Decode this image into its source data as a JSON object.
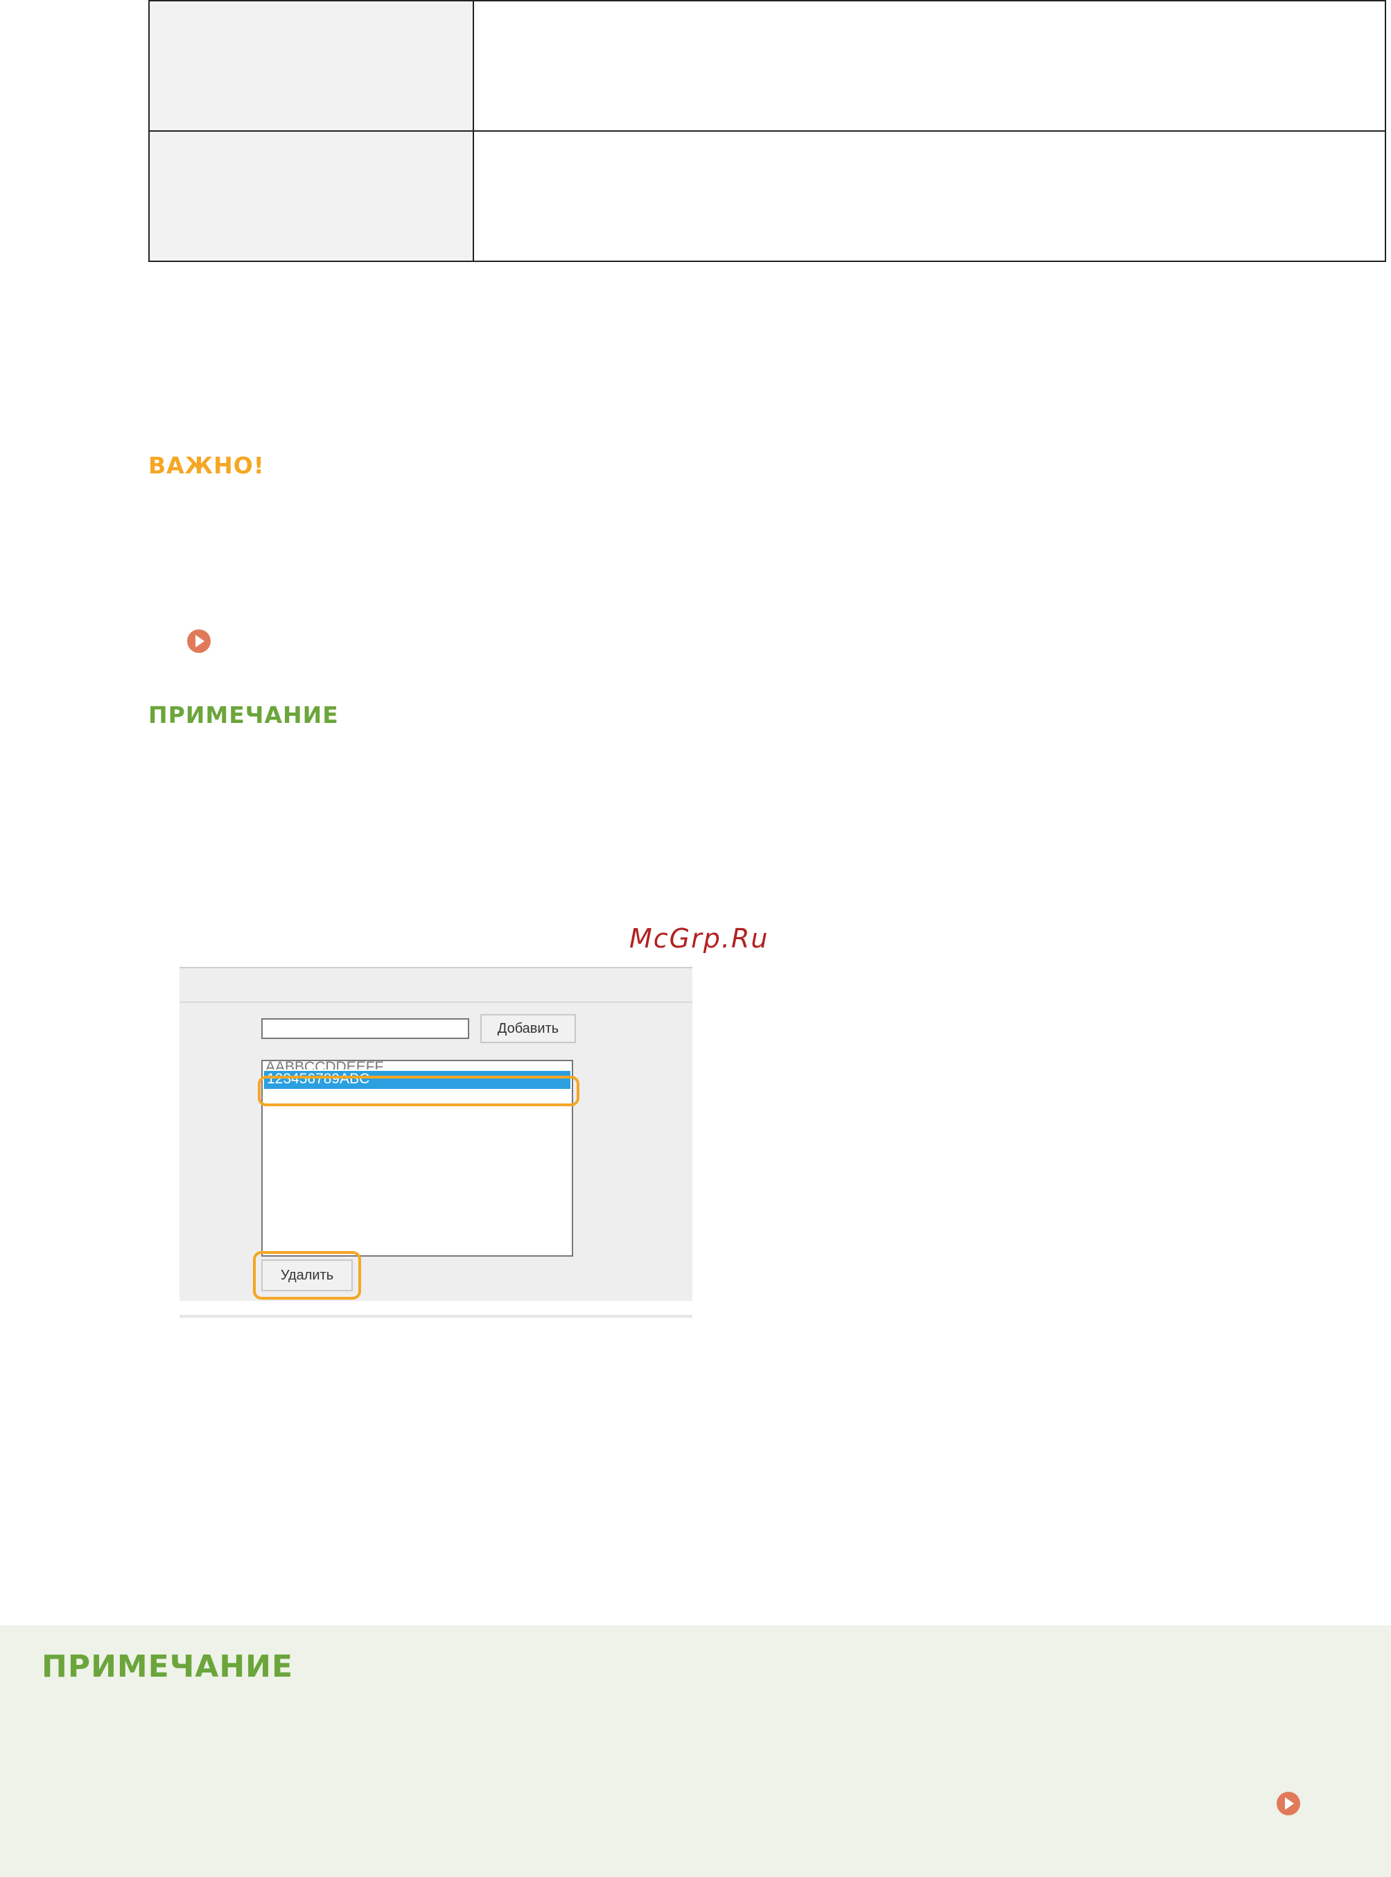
{
  "spec_table": {
    "rows": [
      {
        "label": "",
        "value": ""
      },
      {
        "label": "",
        "value": ""
      }
    ]
  },
  "important": {
    "heading": "ВАЖНО!"
  },
  "note": {
    "heading": "ПРИМЕЧАНИЕ"
  },
  "watermark": "McGrp.Ru",
  "ui_screenshot": {
    "input_value": "",
    "add_button_label": "Добавить",
    "list_items": [
      "AABBCCDDEEFF",
      "123456789ABC"
    ],
    "selected_index": 1,
    "delete_button_label": "Удалить",
    "selection_color": "#2b9fe0",
    "highlight_color": "#f5a623"
  },
  "note_box": {
    "heading": "ПРИМЕЧАНИЕ"
  },
  "icons": {
    "link_arrow": "play-circle-icon"
  },
  "colors": {
    "important": "#f5a623",
    "note": "#6ba53b",
    "link_arrow": "#e07a5a",
    "note_box_bg": "#eef2e8"
  }
}
